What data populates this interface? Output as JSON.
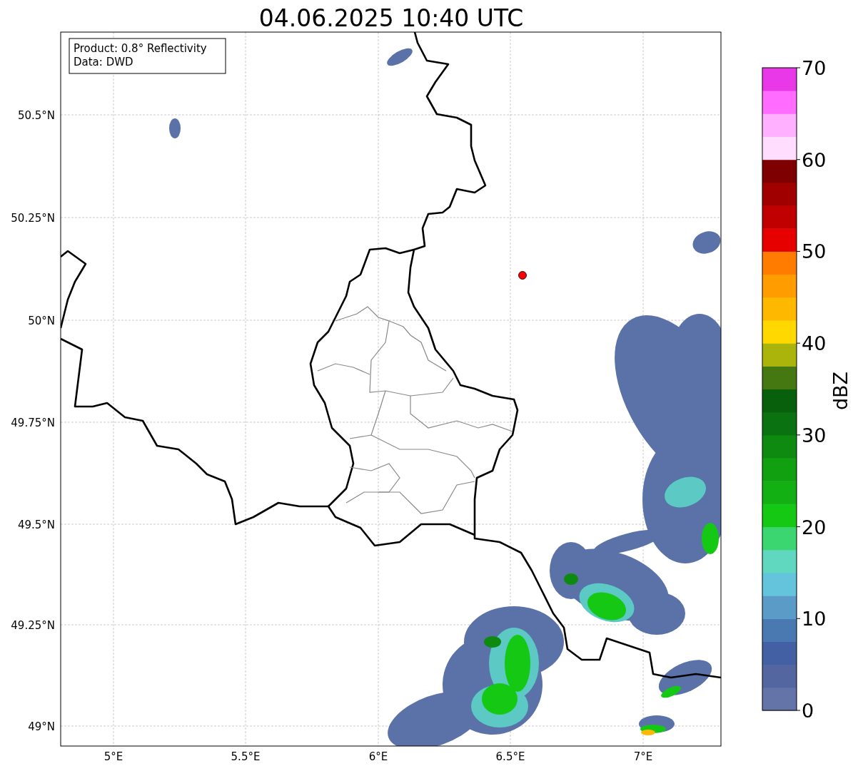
{
  "title": "04.06.2025 10:40 UTC",
  "info_box": [
    "Product: 0.8° Reflectivity",
    "Data: DWD"
  ],
  "map": {
    "x_ticks": [
      "5°E",
      "5.5°E",
      "6°E",
      "6.5°E",
      "7°E"
    ],
    "y_ticks": [
      "50.5°N",
      "50.25°N",
      "50°N",
      "49.75°N",
      "49.5°N",
      "49.25°N",
      "49°N"
    ]
  },
  "colorbar": {
    "label": "dBZ",
    "ticks": [
      "70",
      "60",
      "50",
      "40",
      "30",
      "20",
      "10",
      "0"
    ],
    "levels": [
      {
        "color": "#6473a8"
      },
      {
        "color": "#5466a0"
      },
      {
        "color": "#4460a4"
      },
      {
        "color": "#4a78b0"
      },
      {
        "color": "#5a9cc7"
      },
      {
        "color": "#64c4dc"
      },
      {
        "color": "#60d8c0"
      },
      {
        "color": "#3cd670"
      },
      {
        "color": "#14c814"
      },
      {
        "color": "#12b012"
      },
      {
        "color": "#10a010"
      },
      {
        "color": "#0e8a10"
      },
      {
        "color": "#0a7210"
      },
      {
        "color": "#08600c"
      },
      {
        "color": "#467812"
      },
      {
        "color": "#aab40a"
      },
      {
        "color": "#ffd800"
      },
      {
        "color": "#ffb800"
      },
      {
        "color": "#ff9c00"
      },
      {
        "color": "#ff7c00"
      },
      {
        "color": "#e60000"
      },
      {
        "color": "#c00000"
      },
      {
        "color": "#a00000"
      },
      {
        "color": "#7e0000"
      },
      {
        "color": "#ffddff"
      },
      {
        "color": "#ffb0ff"
      },
      {
        "color": "#ff6cff"
      },
      {
        "color": "#e838e8"
      }
    ]
  }
}
